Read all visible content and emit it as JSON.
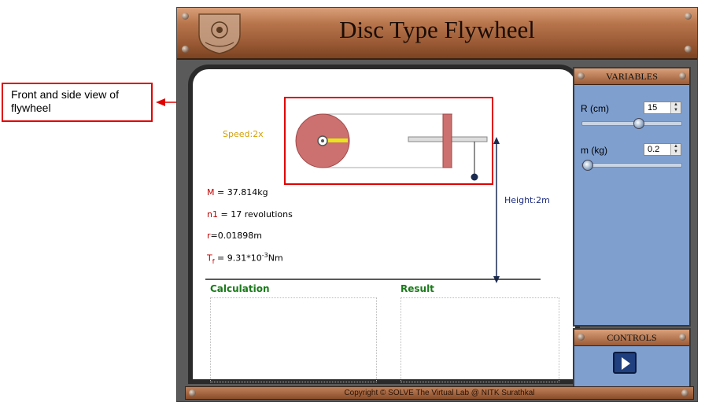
{
  "annotation": {
    "text": "Front and side view of flywheel"
  },
  "app": {
    "title": "Disc Type Flywheel",
    "footer": "Copyright © SOLVE The Virtual Lab @ NITK Surathkal"
  },
  "simulation": {
    "speed_label": "Speed:2x",
    "height_label": "Height:2m",
    "M_label": "M",
    "M_value": " = 37.814kg",
    "n1_label": "n1",
    "n1_value": " = 17 revolutions",
    "r_label": "r",
    "r_value": "=0.01898m",
    "tf_label": "T",
    "tf_sub": "f",
    "tf_value": " = 9.31*10",
    "tf_exp": "-3",
    "tf_unit": "Nm",
    "calculation_label": "Calculation",
    "result_label": "Result"
  },
  "variables": {
    "header": "VARIABLES",
    "radius_label": "R (cm)",
    "radius_value": "15",
    "radius_slider_fraction": 0.57,
    "mass_label": "m (kg)",
    "mass_value": "0.2",
    "mass_slider_fraction": 0.0
  },
  "controls": {
    "header": "CONTROLS",
    "play_icon": "play-icon"
  },
  "colors": {
    "flywheel": "#cd7070",
    "annotation_border": "#e00000",
    "speed_text": "#d4a000",
    "height_text": "#1a2a80",
    "label_red": "#c00000",
    "heading_green": "#1a7a1a",
    "panel_blue": "#7f9fcf"
  }
}
